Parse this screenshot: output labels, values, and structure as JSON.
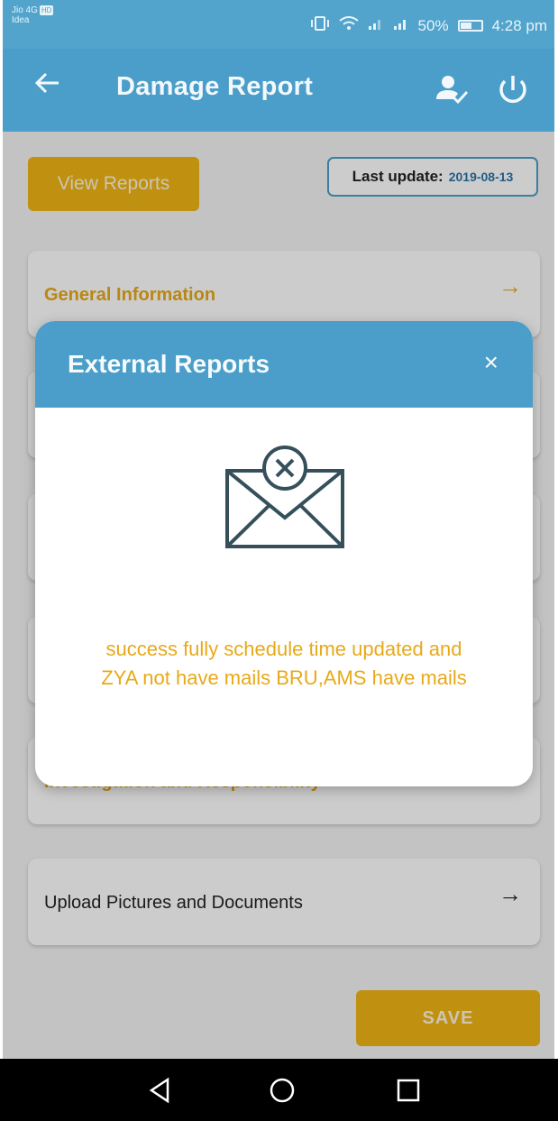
{
  "status_bar": {
    "carrier_line1": "Jio 4G",
    "carrier_badge": "HD",
    "carrier_line2": "Idea",
    "battery": "50%",
    "time": "4:28 pm"
  },
  "app_bar": {
    "title": "Damage Report",
    "icons": [
      "back-arrow-icon",
      "user-check-icon",
      "power-icon"
    ]
  },
  "content": {
    "view_reports_label": "View Reports",
    "last_update_label": "Last update:",
    "last_update_value": "2019-08-13",
    "sections": [
      {
        "label": "General Information",
        "arrow": "→"
      },
      {
        "label": "Investigation and Responsibility",
        "arrow": "→"
      },
      {
        "label": "Upload Pictures and Documents",
        "arrow": "→"
      }
    ],
    "save_label": "SAVE"
  },
  "dialog": {
    "title": "External Reports",
    "close_glyph": "×",
    "message_line1": "success fully schedule time updated and",
    "message_line2": "ZYA not have mails BRU,AMS have mails",
    "icon": "mail-error-icon"
  },
  "colors": {
    "primary": "#4a9ec9",
    "accent": "#f0b414",
    "accent_text": "#e8a918"
  }
}
